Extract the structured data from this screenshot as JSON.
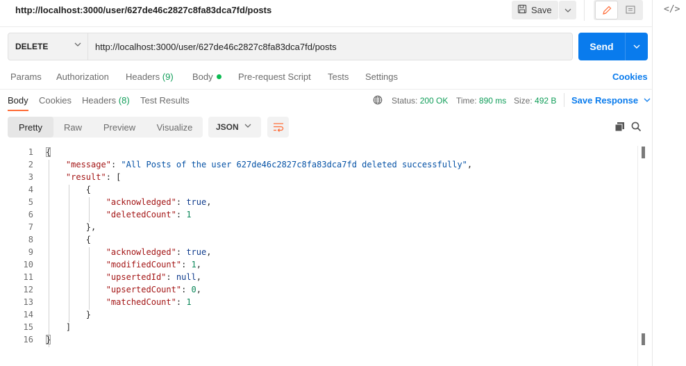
{
  "title": {
    "url": "http://localhost:3000/user/627de46c2827c8fa83dca7fd/posts",
    "save_label": "Save"
  },
  "request": {
    "method": "DELETE",
    "url": "http://localhost:3000/user/627de46c2827c8fa83dca7fd/posts",
    "send_label": "Send"
  },
  "request_tabs": {
    "params": "Params",
    "authorization": "Authorization",
    "headers": "Headers",
    "headers_count": "(9)",
    "body": "Body",
    "prerequest": "Pre-request Script",
    "tests": "Tests",
    "settings": "Settings",
    "cookies": "Cookies"
  },
  "response_tabs": {
    "body": "Body",
    "cookies": "Cookies",
    "headers": "Headers",
    "headers_count": "(8)",
    "test_results": "Test Results"
  },
  "response_meta": {
    "status_label": "Status:",
    "status_value": "200 OK",
    "time_label": "Time:",
    "time_value": "890 ms",
    "size_label": "Size:",
    "size_value": "492 B",
    "save_response": "Save Response"
  },
  "view": {
    "pretty": "Pretty",
    "raw": "Raw",
    "preview": "Preview",
    "visualize": "Visualize",
    "format": "JSON"
  },
  "code": {
    "line_numbers": [
      "1",
      "2",
      "3",
      "4",
      "5",
      "6",
      "7",
      "8",
      "9",
      "10",
      "11",
      "12",
      "13",
      "14",
      "15",
      "16"
    ],
    "message_key": "\"message\"",
    "message_value": "\"All Posts of the user 627de46c2827c8fa83dca7fd deleted successfully\"",
    "result_key": "\"result\"",
    "acknowledged_key": "\"acknowledged\"",
    "deleted_count_key": "\"deletedCount\"",
    "modified_count_key": "\"modifiedCount\"",
    "upserted_id_key": "\"upsertedId\"",
    "upserted_count_key": "\"upsertedCount\"",
    "matched_count_key": "\"matchedCount\"",
    "val_true": "true",
    "val_null": "null",
    "val_1": "1",
    "val_0": "0"
  },
  "colors": {
    "accent": "#097bed",
    "tab_underline": "#ff6c37",
    "status_ok": "#0f9d58"
  }
}
